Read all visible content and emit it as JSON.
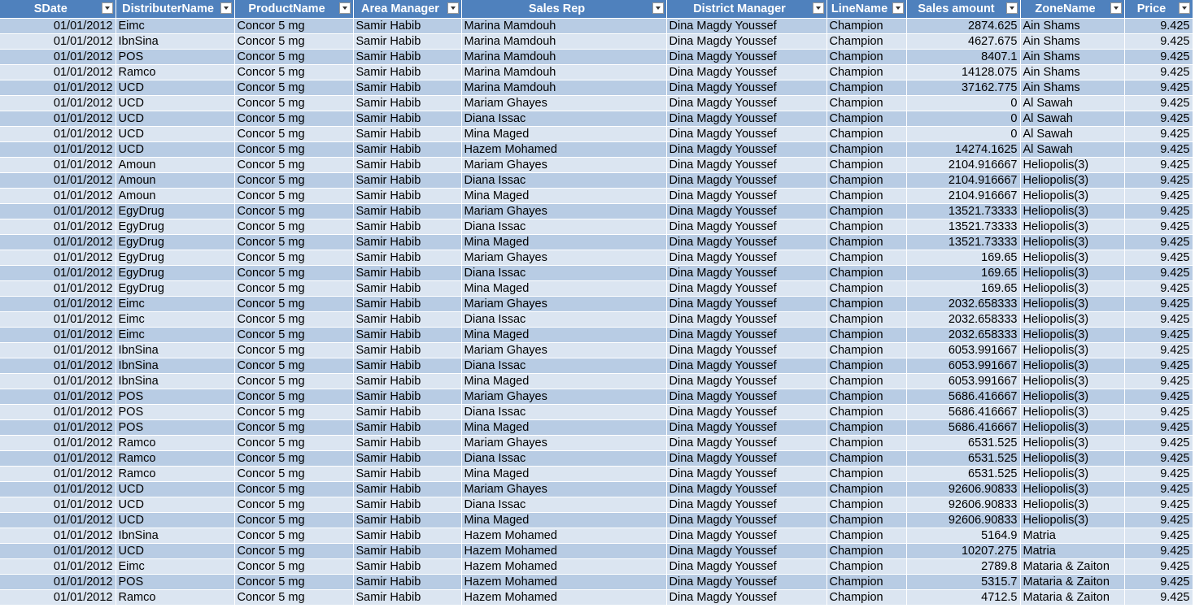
{
  "headers": [
    {
      "label": "SDate",
      "key": "sdate"
    },
    {
      "label": "DistributerName",
      "key": "distributer"
    },
    {
      "label": "ProductName",
      "key": "product"
    },
    {
      "label": "Area Manager",
      "key": "area_manager"
    },
    {
      "label": "Sales Rep",
      "key": "sales_rep"
    },
    {
      "label": "District Manager",
      "key": "district_manager"
    },
    {
      "label": "LineName",
      "key": "line"
    },
    {
      "label": "Sales amount",
      "key": "sales_amount"
    },
    {
      "label": "ZoneName",
      "key": "zone"
    },
    {
      "label": "Price",
      "key": "price"
    }
  ],
  "rows": [
    [
      "01/01/2012",
      "Eimc",
      "Concor 5 mg",
      "Samir Habib",
      "Marina Mamdouh",
      "Dina Magdy Youssef",
      "Champion",
      "2874.625",
      "Ain Shams",
      "9.425"
    ],
    [
      "01/01/2012",
      "IbnSina",
      "Concor 5 mg",
      "Samir Habib",
      "Marina Mamdouh",
      "Dina Magdy Youssef",
      "Champion",
      "4627.675",
      "Ain Shams",
      "9.425"
    ],
    [
      "01/01/2012",
      "POS",
      "Concor 5 mg",
      "Samir Habib",
      "Marina Mamdouh",
      "Dina Magdy Youssef",
      "Champion",
      "8407.1",
      "Ain Shams",
      "9.425"
    ],
    [
      "01/01/2012",
      "Ramco",
      "Concor 5 mg",
      "Samir Habib",
      "Marina Mamdouh",
      "Dina Magdy Youssef",
      "Champion",
      "14128.075",
      "Ain Shams",
      "9.425"
    ],
    [
      "01/01/2012",
      "UCD",
      "Concor 5 mg",
      "Samir Habib",
      "Marina Mamdouh",
      "Dina Magdy Youssef",
      "Champion",
      "37162.775",
      "Ain Shams",
      "9.425"
    ],
    [
      "01/01/2012",
      "UCD",
      "Concor 5 mg",
      "Samir Habib",
      "Mariam Ghayes",
      "Dina Magdy Youssef",
      "Champion",
      "0",
      "Al Sawah",
      "9.425"
    ],
    [
      "01/01/2012",
      "UCD",
      "Concor 5 mg",
      "Samir Habib",
      "Diana Issac",
      "Dina Magdy Youssef",
      "Champion",
      "0",
      "Al Sawah",
      "9.425"
    ],
    [
      "01/01/2012",
      "UCD",
      "Concor 5 mg",
      "Samir Habib",
      "Mina Maged",
      "Dina Magdy Youssef",
      "Champion",
      "0",
      "Al Sawah",
      "9.425"
    ],
    [
      "01/01/2012",
      "UCD",
      "Concor 5 mg",
      "Samir Habib",
      "Hazem Mohamed",
      "Dina Magdy Youssef",
      "Champion",
      "14274.1625",
      "Al Sawah",
      "9.425"
    ],
    [
      "01/01/2012",
      "Amoun",
      "Concor 5 mg",
      "Samir Habib",
      "Mariam Ghayes",
      "Dina Magdy Youssef",
      "Champion",
      "2104.916667",
      "Heliopolis(3)",
      "9.425"
    ],
    [
      "01/01/2012",
      "Amoun",
      "Concor 5 mg",
      "Samir Habib",
      "Diana Issac",
      "Dina Magdy Youssef",
      "Champion",
      "2104.916667",
      "Heliopolis(3)",
      "9.425"
    ],
    [
      "01/01/2012",
      "Amoun",
      "Concor 5 mg",
      "Samir Habib",
      "Mina Maged",
      "Dina Magdy Youssef",
      "Champion",
      "2104.916667",
      "Heliopolis(3)",
      "9.425"
    ],
    [
      "01/01/2012",
      "EgyDrug",
      "Concor 5 mg",
      "Samir Habib",
      "Mariam Ghayes",
      "Dina Magdy Youssef",
      "Champion",
      "13521.73333",
      "Heliopolis(3)",
      "9.425"
    ],
    [
      "01/01/2012",
      "EgyDrug",
      "Concor 5 mg",
      "Samir Habib",
      "Diana Issac",
      "Dina Magdy Youssef",
      "Champion",
      "13521.73333",
      "Heliopolis(3)",
      "9.425"
    ],
    [
      "01/01/2012",
      "EgyDrug",
      "Concor 5 mg",
      "Samir Habib",
      "Mina Maged",
      "Dina Magdy Youssef",
      "Champion",
      "13521.73333",
      "Heliopolis(3)",
      "9.425"
    ],
    [
      "01/01/2012",
      "EgyDrug",
      "Concor 5 mg",
      "Samir Habib",
      "Mariam Ghayes",
      "Dina Magdy Youssef",
      "Champion",
      "169.65",
      "Heliopolis(3)",
      "9.425"
    ],
    [
      "01/01/2012",
      "EgyDrug",
      "Concor 5 mg",
      "Samir Habib",
      "Diana Issac",
      "Dina Magdy Youssef",
      "Champion",
      "169.65",
      "Heliopolis(3)",
      "9.425"
    ],
    [
      "01/01/2012",
      "EgyDrug",
      "Concor 5 mg",
      "Samir Habib",
      "Mina Maged",
      "Dina Magdy Youssef",
      "Champion",
      "169.65",
      "Heliopolis(3)",
      "9.425"
    ],
    [
      "01/01/2012",
      "Eimc",
      "Concor 5 mg",
      "Samir Habib",
      "Mariam Ghayes",
      "Dina Magdy Youssef",
      "Champion",
      "2032.658333",
      "Heliopolis(3)",
      "9.425"
    ],
    [
      "01/01/2012",
      "Eimc",
      "Concor 5 mg",
      "Samir Habib",
      "Diana Issac",
      "Dina Magdy Youssef",
      "Champion",
      "2032.658333",
      "Heliopolis(3)",
      "9.425"
    ],
    [
      "01/01/2012",
      "Eimc",
      "Concor 5 mg",
      "Samir Habib",
      "Mina Maged",
      "Dina Magdy Youssef",
      "Champion",
      "2032.658333",
      "Heliopolis(3)",
      "9.425"
    ],
    [
      "01/01/2012",
      "IbnSina",
      "Concor 5 mg",
      "Samir Habib",
      "Mariam Ghayes",
      "Dina Magdy Youssef",
      "Champion",
      "6053.991667",
      "Heliopolis(3)",
      "9.425"
    ],
    [
      "01/01/2012",
      "IbnSina",
      "Concor 5 mg",
      "Samir Habib",
      "Diana Issac",
      "Dina Magdy Youssef",
      "Champion",
      "6053.991667",
      "Heliopolis(3)",
      "9.425"
    ],
    [
      "01/01/2012",
      "IbnSina",
      "Concor 5 mg",
      "Samir Habib",
      "Mina Maged",
      "Dina Magdy Youssef",
      "Champion",
      "6053.991667",
      "Heliopolis(3)",
      "9.425"
    ],
    [
      "01/01/2012",
      "POS",
      "Concor 5 mg",
      "Samir Habib",
      "Mariam Ghayes",
      "Dina Magdy Youssef",
      "Champion",
      "5686.416667",
      "Heliopolis(3)",
      "9.425"
    ],
    [
      "01/01/2012",
      "POS",
      "Concor 5 mg",
      "Samir Habib",
      "Diana Issac",
      "Dina Magdy Youssef",
      "Champion",
      "5686.416667",
      "Heliopolis(3)",
      "9.425"
    ],
    [
      "01/01/2012",
      "POS",
      "Concor 5 mg",
      "Samir Habib",
      "Mina Maged",
      "Dina Magdy Youssef",
      "Champion",
      "5686.416667",
      "Heliopolis(3)",
      "9.425"
    ],
    [
      "01/01/2012",
      "Ramco",
      "Concor 5 mg",
      "Samir Habib",
      "Mariam Ghayes",
      "Dina Magdy Youssef",
      "Champion",
      "6531.525",
      "Heliopolis(3)",
      "9.425"
    ],
    [
      "01/01/2012",
      "Ramco",
      "Concor 5 mg",
      "Samir Habib",
      "Diana Issac",
      "Dina Magdy Youssef",
      "Champion",
      "6531.525",
      "Heliopolis(3)",
      "9.425"
    ],
    [
      "01/01/2012",
      "Ramco",
      "Concor 5 mg",
      "Samir Habib",
      "Mina Maged",
      "Dina Magdy Youssef",
      "Champion",
      "6531.525",
      "Heliopolis(3)",
      "9.425"
    ],
    [
      "01/01/2012",
      "UCD",
      "Concor 5 mg",
      "Samir Habib",
      "Mariam Ghayes",
      "Dina Magdy Youssef",
      "Champion",
      "92606.90833",
      "Heliopolis(3)",
      "9.425"
    ],
    [
      "01/01/2012",
      "UCD",
      "Concor 5 mg",
      "Samir Habib",
      "Diana Issac",
      "Dina Magdy Youssef",
      "Champion",
      "92606.90833",
      "Heliopolis(3)",
      "9.425"
    ],
    [
      "01/01/2012",
      "UCD",
      "Concor 5 mg",
      "Samir Habib",
      "Mina Maged",
      "Dina Magdy Youssef",
      "Champion",
      "92606.90833",
      "Heliopolis(3)",
      "9.425"
    ],
    [
      "01/01/2012",
      "IbnSina",
      "Concor 5 mg",
      "Samir Habib",
      "Hazem Mohamed",
      "Dina Magdy Youssef",
      "Champion",
      "5164.9",
      "Matria",
      "9.425"
    ],
    [
      "01/01/2012",
      "UCD",
      "Concor 5 mg",
      "Samir Habib",
      "Hazem Mohamed",
      "Dina Magdy Youssef",
      "Champion",
      "10207.275",
      "Matria",
      "9.425"
    ],
    [
      "01/01/2012",
      "Eimc",
      "Concor 5 mg",
      "Samir Habib",
      "Hazem Mohamed",
      "Dina Magdy Youssef",
      "Champion",
      "2789.8",
      "Mataria & Zaiton",
      "9.425"
    ],
    [
      "01/01/2012",
      "POS",
      "Concor 5 mg",
      "Samir Habib",
      "Hazem Mohamed",
      "Dina Magdy Youssef",
      "Champion",
      "5315.7",
      "Mataria & Zaiton",
      "9.425"
    ],
    [
      "01/01/2012",
      "Ramco",
      "Concor 5 mg",
      "Samir Habib",
      "Hazem Mohamed",
      "Dina Magdy Youssef",
      "Champion",
      "4712.5",
      "Mataria & Zaiton",
      "9.425"
    ]
  ],
  "colors": {
    "header_bg": "#4f81bd",
    "row_odd": "#b8cce4",
    "row_even": "#dbe5f1"
  }
}
